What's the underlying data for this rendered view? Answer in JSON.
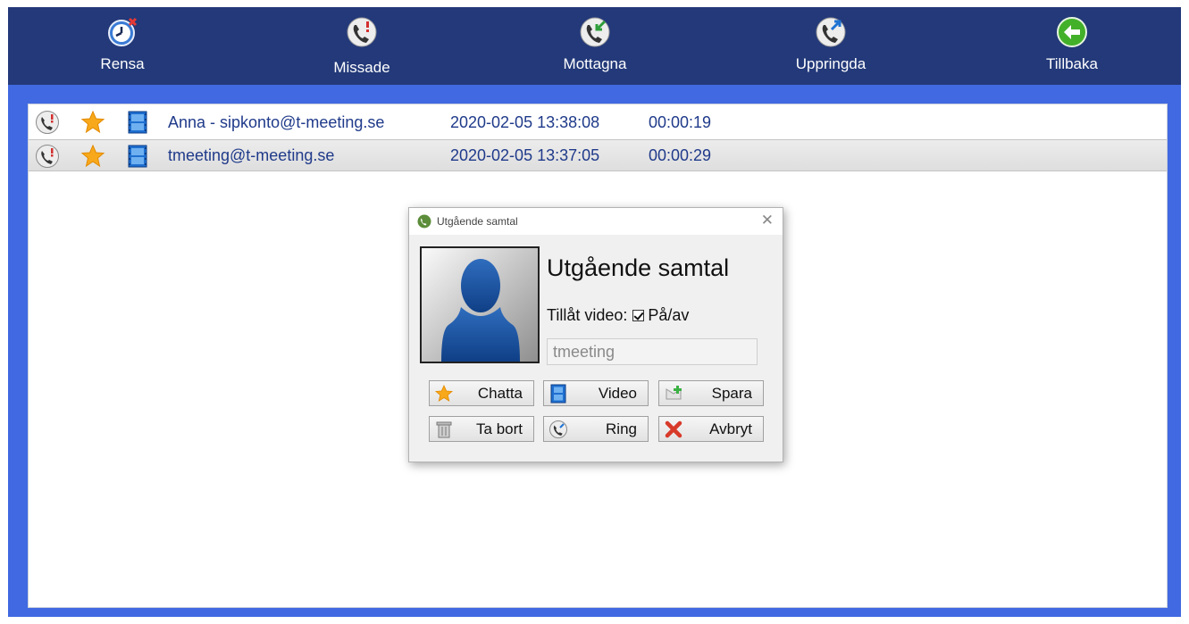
{
  "toolbar": {
    "items": [
      {
        "label": "Rensa",
        "icon": "clock-clear-icon"
      },
      {
        "label": "Missade",
        "icon": "missed-call-icon"
      },
      {
        "label": "Mottagna",
        "icon": "received-call-icon"
      },
      {
        "label": "Uppringda",
        "icon": "dialed-call-icon"
      },
      {
        "label": "Tillbaka",
        "icon": "back-arrow-icon"
      }
    ]
  },
  "calls": [
    {
      "name": "Anna - sipkonto@t-meeting.se",
      "date": "2020-02-05 13:38:08",
      "duration": "00:00:19"
    },
    {
      "name": "tmeeting@t-meeting.se",
      "date": "2020-02-05 13:37:05",
      "duration": "00:00:29"
    }
  ],
  "dialog": {
    "window_title": "Utgående samtal",
    "heading": "Utgående samtal",
    "video_label": "Tillåt video:",
    "video_checked": true,
    "video_toggle_label": "På/av",
    "input_value": "tmeeting",
    "buttons": {
      "chat": "Chatta",
      "video": "Video",
      "save": "Spara",
      "delete": "Ta bort",
      "call": "Ring",
      "cancel": "Avbryt"
    }
  },
  "colors": {
    "toolbar_bg": "#233979",
    "content_bg": "#4169e1",
    "text_blue": "#1f3a8a"
  }
}
